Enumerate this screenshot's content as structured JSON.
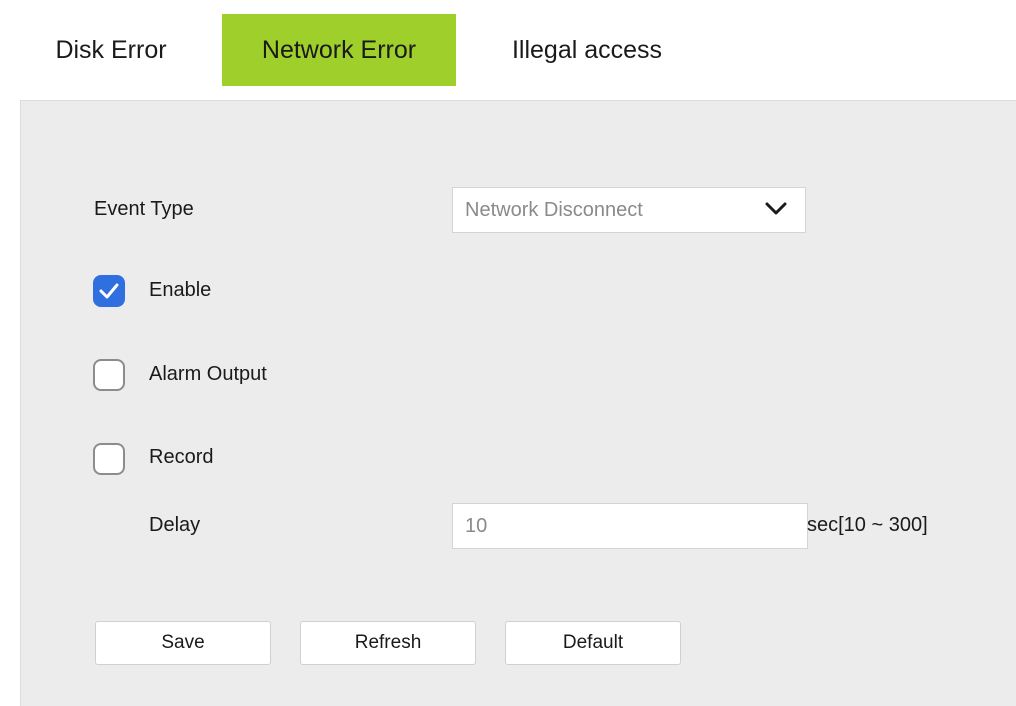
{
  "tabs": [
    {
      "label": "Disk Error",
      "active": false
    },
    {
      "label": "Network Error",
      "active": true
    },
    {
      "label": "Illegal access",
      "active": false
    }
  ],
  "form": {
    "event_type_label": "Event Type",
    "event_type_value": "Network Disconnect",
    "enable_label": "Enable",
    "enable_checked": true,
    "alarm_output_label": "Alarm Output",
    "alarm_output_checked": false,
    "record_label": "Record",
    "record_checked": false,
    "delay_label": "Delay",
    "delay_value": "10",
    "delay_unit": "sec[10 ~ 300]"
  },
  "buttons": {
    "save": "Save",
    "refresh": "Refresh",
    "default": "Default"
  },
  "colors": {
    "active_tab": "#9fcf2a",
    "checkbox_checked": "#2f6fe0",
    "panel_bg": "#ececec"
  },
  "icons": {
    "dropdown": "chevron-down-icon",
    "check": "checkmark-icon"
  }
}
